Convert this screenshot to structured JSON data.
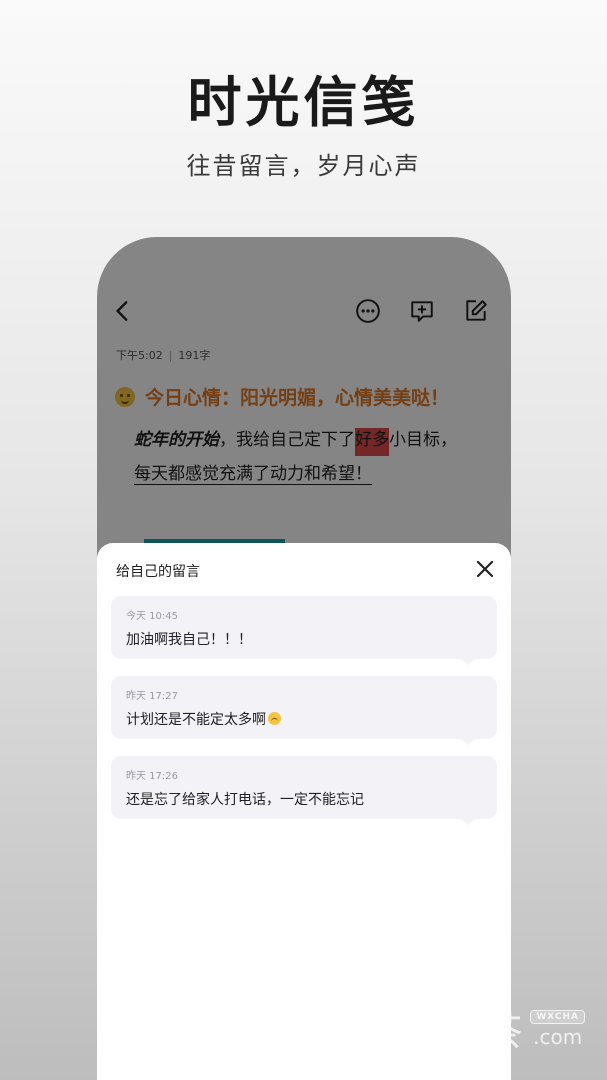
{
  "hero": {
    "title": "时光信笺",
    "subtitle": "往昔留言，岁月心声"
  },
  "editor": {
    "toolbar": {
      "back_icon": "chevron-left-icon",
      "more_icon": "more-circle-icon",
      "comment_icon": "comment-add-icon",
      "edit_icon": "edit-icon"
    },
    "meta": {
      "time": "下午5:02",
      "separator": "|",
      "word_count": "191字"
    },
    "mood": {
      "emoji_icon": "smile-emoji-icon",
      "text": "今日心情：阳光明媚，心情美美哒！"
    },
    "body": {
      "line1_italic": "蛇年的开始",
      "line1_mid": "，我给自己定下了",
      "line1_highlight": "好多",
      "line1_end": "小目标，",
      "line2": "每天都感觉充满了动力和希望！"
    }
  },
  "sheet": {
    "title": "给自己的留言",
    "close_icon": "close-icon",
    "messages": [
      {
        "time": "今天 10:45",
        "text": "加油啊我自己！！！"
      },
      {
        "time": "昨天 17:27",
        "text": "计划还是不能定太多啊",
        "emoji_icon": "worried-emoji-icon"
      },
      {
        "time": "昨天 17:26",
        "text": "还是忘了给家人打电话，一定不能忘记"
      }
    ]
  },
  "watermark": {
    "cn": "微茶",
    "badge": "WXCHA",
    "com": ".com"
  },
  "colors": {
    "mood_orange": "#e07a2a",
    "highlight_red": "#e04a4a",
    "teal": "#1aa3a8",
    "bubble_bg": "#f2f2f7"
  }
}
